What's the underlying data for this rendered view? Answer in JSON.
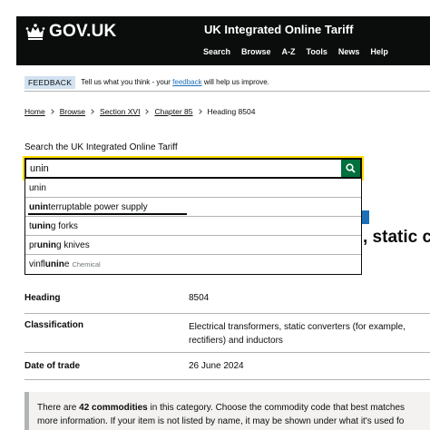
{
  "header": {
    "logo_text": "GOV.UK",
    "service_name": "UK Integrated Online Tariff",
    "nav": [
      "Search",
      "Browse",
      "A-Z",
      "Tools",
      "News",
      "Help"
    ]
  },
  "phase_banner": {
    "tag": "FEEDBACK",
    "text_before": "Tell us what you think - your ",
    "link": "feedback",
    "text_after": " will help us improve."
  },
  "breadcrumbs": {
    "items": [
      "Home",
      "Browse",
      "Section XVI",
      "Chapter 85"
    ],
    "current": "Heading 8504"
  },
  "search": {
    "label": "Search the UK Integrated Online Tariff",
    "value": "unin",
    "suggestions": [
      {
        "pre": "",
        "match": "",
        "post": "unin",
        "note": ""
      },
      {
        "pre": "",
        "match": "unin",
        "post": "terruptable power supply",
        "note": ""
      },
      {
        "pre": "t",
        "match": "unin",
        "post": "g forks",
        "note": ""
      },
      {
        "pre": "pr",
        "match": "unin",
        "post": "g knives",
        "note": ""
      },
      {
        "pre": "vinfl",
        "match": "unin",
        "post": "e",
        "note": "Chemical"
      }
    ]
  },
  "heading_fragment": ", static c",
  "summary": {
    "heading_label": "Heading",
    "heading_value": "8504",
    "classification_label": "Classification",
    "classification_value": "Electrical transformers, static converters (for example, rectifiers) and inductors",
    "date_label": "Date of trade",
    "date_value": "26 June 2024"
  },
  "inset": {
    "line1_pre": "There are ",
    "count": "42 commodities",
    "line1_post": " in this category. Choose the commodity code that best matches",
    "line2": "more information. If your item is not listed by name, it may be shown under what it's used fo"
  },
  "colors": {
    "header_bg": "#0b0c0c",
    "search_button": "#00703c",
    "focus": "#ffdd00",
    "link": "#1d70b8",
    "tag_bg": "#d2e2f1"
  }
}
